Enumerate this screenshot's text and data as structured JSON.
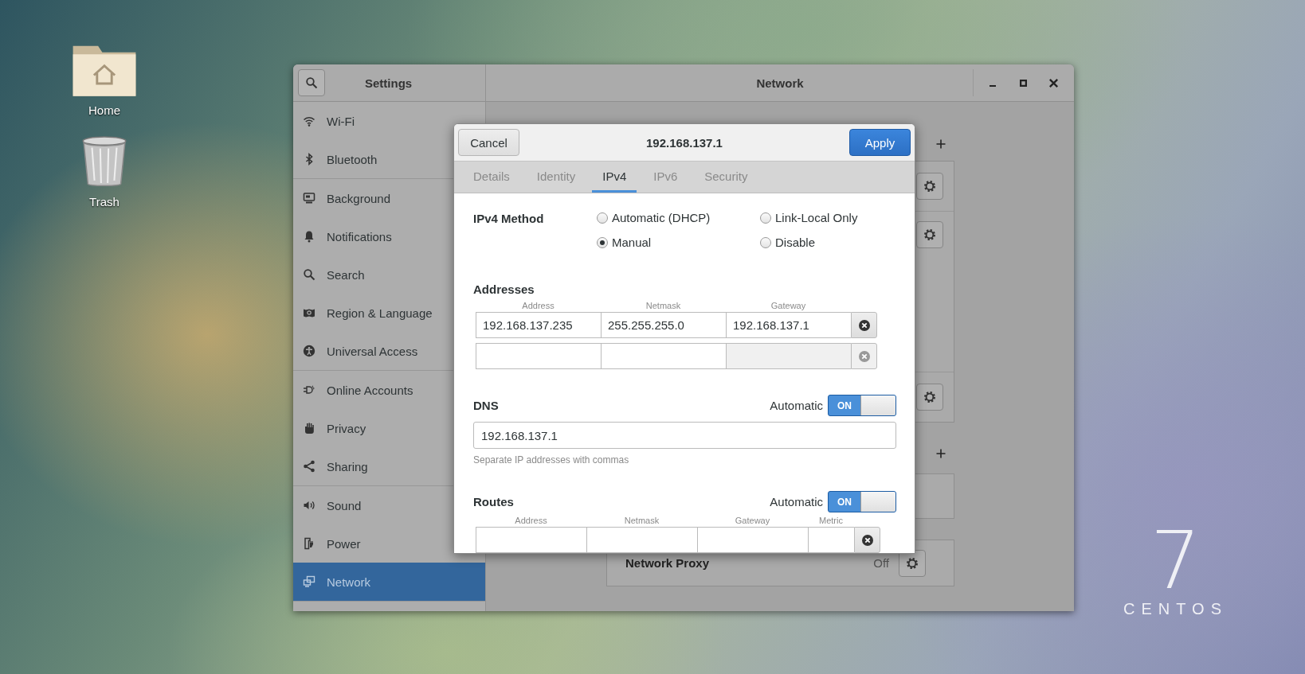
{
  "desktop": {
    "icons": [
      {
        "kind": "folder",
        "label": "Home"
      },
      {
        "kind": "trash",
        "label": "Trash"
      }
    ],
    "wallpaper_logo": {
      "numeral": "7",
      "wordmark": "CENTOS"
    }
  },
  "window": {
    "sidebar_title": "Settings",
    "title": "Network"
  },
  "sidebar": {
    "groups": [
      {
        "items": [
          {
            "kind": "wifi",
            "label": "Wi-Fi",
            "selected": false
          },
          {
            "kind": "bluetooth",
            "label": "Bluetooth",
            "selected": false
          }
        ]
      },
      {
        "items": [
          {
            "kind": "background",
            "label": "Background",
            "selected": false
          },
          {
            "kind": "notifications",
            "label": "Notifications",
            "selected": false
          },
          {
            "kind": "search",
            "label": "Search",
            "selected": false
          },
          {
            "kind": "region",
            "label": "Region & Language",
            "selected": false
          },
          {
            "kind": "access",
            "label": "Universal Access",
            "selected": false
          }
        ]
      },
      {
        "items": [
          {
            "kind": "accounts",
            "label": "Online Accounts",
            "selected": false
          },
          {
            "kind": "privacy",
            "label": "Privacy",
            "selected": false
          },
          {
            "kind": "sharing",
            "label": "Sharing",
            "selected": false
          }
        ]
      },
      {
        "items": [
          {
            "kind": "sound",
            "label": "Sound",
            "selected": false
          },
          {
            "kind": "power",
            "label": "Power",
            "selected": false
          },
          {
            "kind": "network",
            "label": "Network",
            "selected": true
          }
        ]
      }
    ]
  },
  "network_proxy": {
    "label": "Network Proxy",
    "value": "Off"
  },
  "dialog": {
    "title": "192.168.137.1",
    "cancel": "Cancel",
    "apply": "Apply",
    "tabs": [
      {
        "label": "Details",
        "selected": false
      },
      {
        "label": "Identity",
        "selected": false
      },
      {
        "label": "IPv4",
        "selected": true
      },
      {
        "label": "IPv6",
        "selected": false
      },
      {
        "label": "Security",
        "selected": false
      }
    ],
    "ipv4_method": {
      "label": "IPv4 Method",
      "options": [
        {
          "label": "Automatic (DHCP)",
          "selected": false
        },
        {
          "label": "Link-Local Only",
          "selected": false
        },
        {
          "label": "Manual",
          "selected": true
        },
        {
          "label": "Disable",
          "selected": false
        }
      ]
    },
    "addresses": {
      "title": "Addresses",
      "columns": [
        "Address",
        "Netmask",
        "Gateway"
      ],
      "rows": [
        {
          "cells": [
            "192.168.137.235",
            "255.255.255.0",
            "192.168.137.1"
          ],
          "disabled": false
        },
        {
          "cells": [],
          "disabled": true
        }
      ]
    },
    "dns": {
      "title": "DNS",
      "automatic_label": "Automatic",
      "switch": {
        "on": true,
        "label": "ON"
      },
      "value": "192.168.137.1",
      "hint": "Separate IP addresses with commas"
    },
    "routes": {
      "title": "Routes",
      "automatic_label": "Automatic",
      "switch": {
        "on": true,
        "label": "ON"
      },
      "columns": [
        "Address",
        "Netmask",
        "Gateway",
        "Metric"
      ],
      "rows": [
        {
          "cells": [],
          "disabled": false
        }
      ]
    }
  }
}
